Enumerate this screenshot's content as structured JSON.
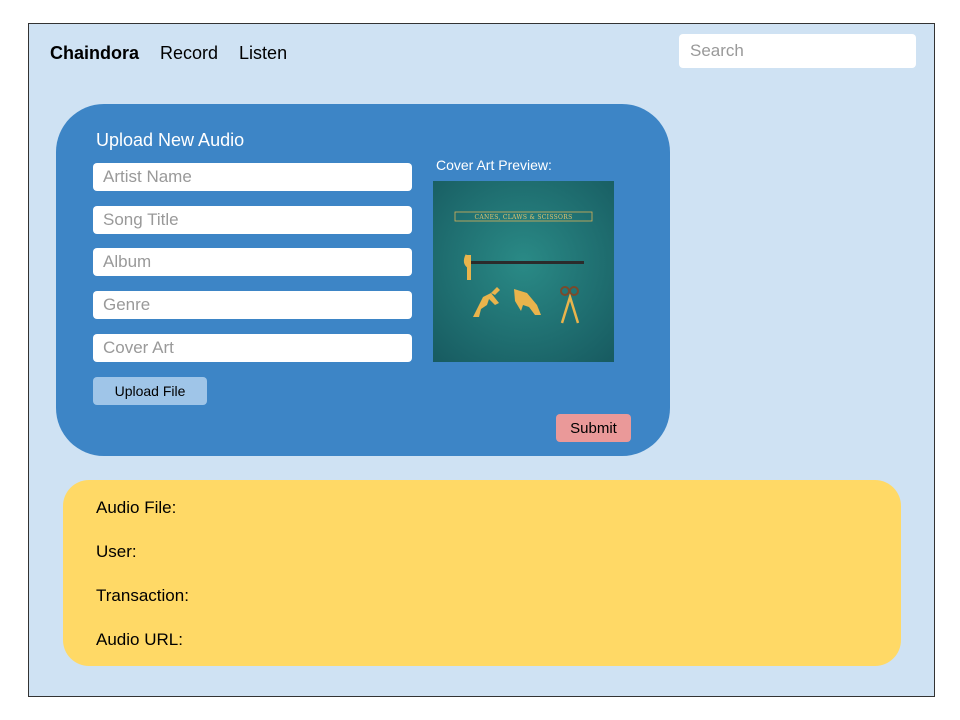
{
  "nav": {
    "brand": "Chaindora",
    "links": [
      "Record",
      "Listen"
    ],
    "search_placeholder": "Search"
  },
  "upload": {
    "title": "Upload New Audio",
    "fields": {
      "artist": "Artist Name",
      "song": "Song Title",
      "album": "Album",
      "genre": "Genre",
      "cover": "Cover Art"
    },
    "upload_button": "Upload File",
    "cover_preview_label": "Cover Art Preview:",
    "cover_art_text": "CANES, CLAWS & SCISSORS",
    "submit_button": "Submit"
  },
  "info": {
    "rows": [
      "Audio File:",
      "User:",
      "Transaction:",
      "Audio URL:"
    ]
  },
  "colors": {
    "background": "#cfe2f3",
    "upload_panel": "#3d85c6",
    "info_panel": "#ffd966",
    "upload_button": "#9fc5e8",
    "submit_button": "#ea9999",
    "cover_art": "#1f6b6c"
  }
}
